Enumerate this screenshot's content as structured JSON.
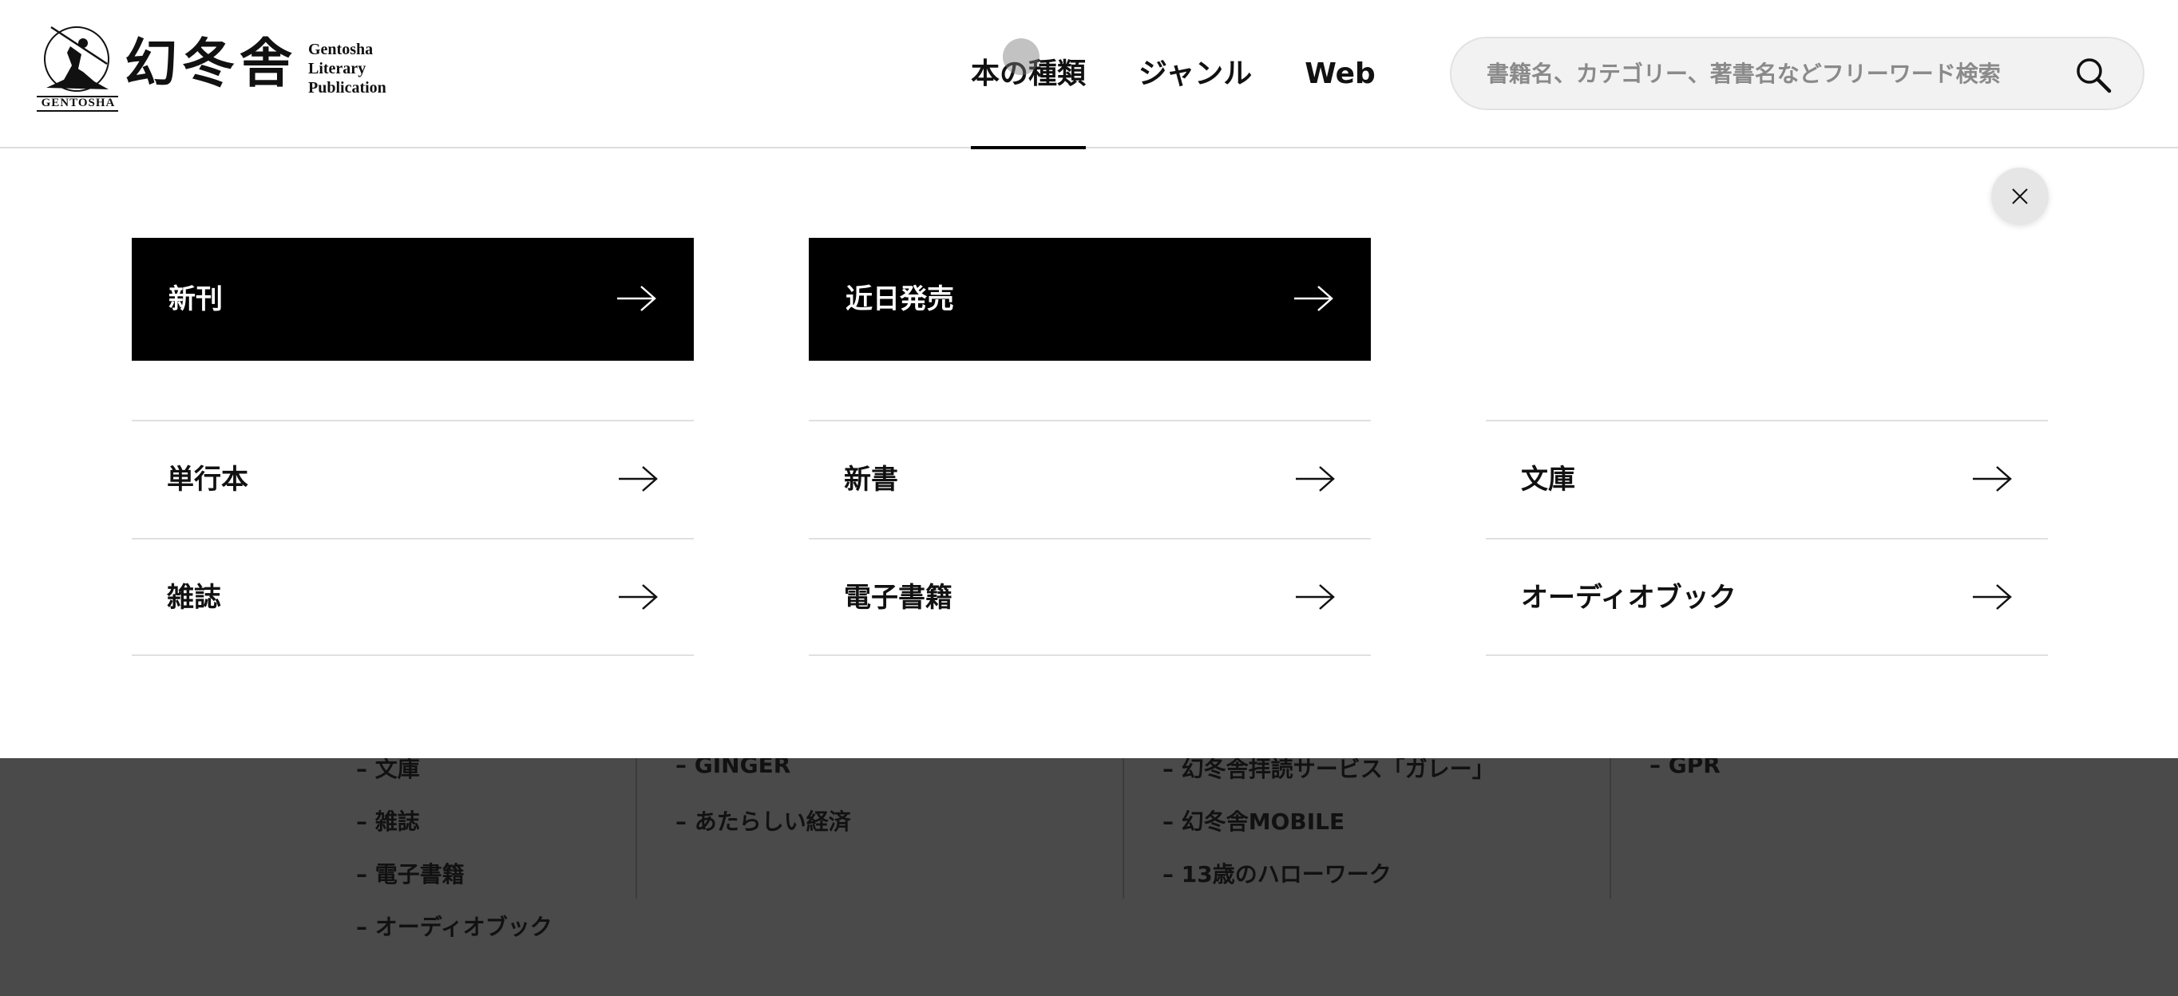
{
  "header": {
    "logo": {
      "kanji": "幻冬舎",
      "mark_text": "GENTOSHA",
      "en_lines": [
        "Gentosha",
        "Literary",
        "Publication"
      ]
    },
    "nav": [
      {
        "label": "本の種類",
        "active": true
      },
      {
        "label": "ジャンル",
        "active": false
      },
      {
        "label": "Web",
        "active": false
      }
    ],
    "search": {
      "placeholder": "書籍名、カテゴリー、著書名などフリーワード検索",
      "value": ""
    }
  },
  "panel": {
    "featured": [
      {
        "label": "新刊"
      },
      {
        "label": "近日発売"
      }
    ],
    "rows": [
      {
        "label": "単行本"
      },
      {
        "label": "新書"
      },
      {
        "label": "文庫"
      },
      {
        "label": "雑誌"
      },
      {
        "label": "電子書籍"
      },
      {
        "label": "オーディオブック"
      }
    ]
  },
  "footer": {
    "col1": [
      "文庫",
      "雑誌",
      "電子書籍",
      "オーディオブック"
    ],
    "col2": [
      "GINGER",
      "あたらしい経済"
    ],
    "col3": [
      "幻冬舎拝読サービス「ガレー」",
      "幻冬舎MOBILE",
      "13歳のハローワーク"
    ],
    "col4": [
      "GPR"
    ],
    "bullet": "–"
  },
  "colors": {
    "accent": "#000000",
    "overlay": "#4a4a4a",
    "panel_bg": "#ffffff",
    "search_bg": "#f2f2f2"
  },
  "icons": {
    "search": "magnifier-icon",
    "close": "close-icon",
    "arrow": "arrow-right-icon"
  }
}
